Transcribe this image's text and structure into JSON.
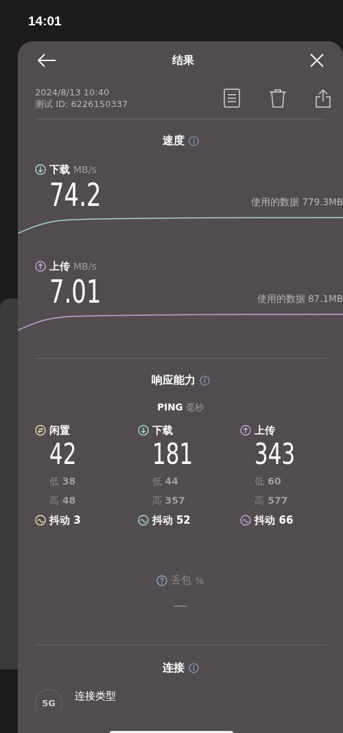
{
  "status_bar": {
    "time": "14:01"
  },
  "header": {
    "title": "结果"
  },
  "meta": {
    "date": "2024/8/13 10:40",
    "test_id": "测试 ID: 6226150337"
  },
  "speed": {
    "title": "速度",
    "items": [
      {
        "kind": "download",
        "label": "下载",
        "unit": "MB/s",
        "value": "74.2",
        "data_used": "使用的数据 779.3MB",
        "color": "#a9d6cf"
      },
      {
        "kind": "upload",
        "label": "上传",
        "unit": "MB/s",
        "value": "7.01",
        "data_used": "使用的数据 87.1MB",
        "color": "#c3a3d6"
      }
    ]
  },
  "responsiveness": {
    "title": "响应能力",
    "ping_label": "PING",
    "ping_unit": "毫秒",
    "items": [
      {
        "kind": "idle",
        "label": "闲置",
        "value": "42",
        "low_label": "低",
        "low": "38",
        "high_label": "高",
        "high": "48",
        "jitter_label": "抖动",
        "jitter": "3",
        "color": "#e3d9a0"
      },
      {
        "kind": "download",
        "label": "下载",
        "value": "181",
        "low_label": "低",
        "low": "44",
        "high_label": "高",
        "high": "357",
        "jitter_label": "抖动",
        "jitter": "52",
        "color": "#a9d6cf"
      },
      {
        "kind": "upload",
        "label": "上传",
        "value": "343",
        "low_label": "低",
        "low": "60",
        "high_label": "高",
        "high": "577",
        "jitter_label": "抖动",
        "jitter": "66",
        "color": "#c3a3d6"
      }
    ]
  },
  "packet_loss": {
    "label": "丢包",
    "unit": "%",
    "value": "—"
  },
  "connection": {
    "title": "连接",
    "items": [
      {
        "badge": "5G",
        "label": "连接类型"
      }
    ]
  }
}
